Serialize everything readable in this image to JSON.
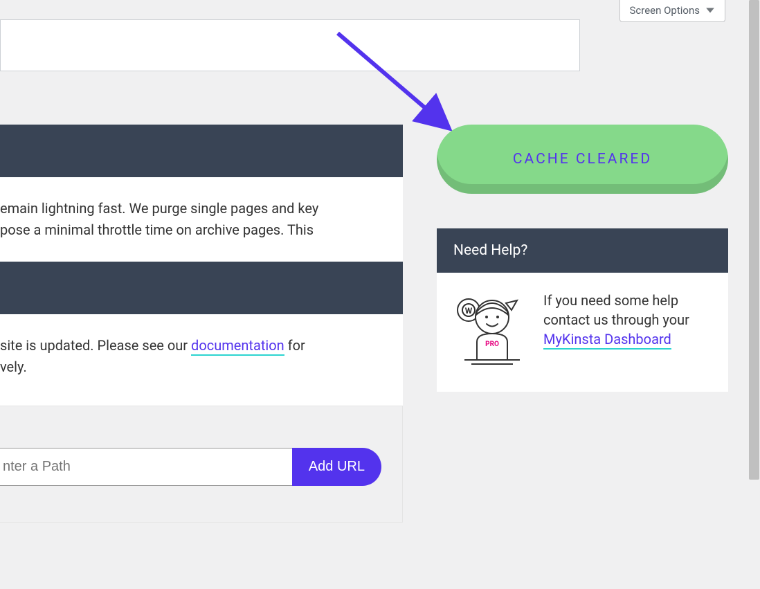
{
  "screen_options": {
    "label": "Screen Options"
  },
  "main": {
    "text1a": "emain lightning fast. We purge single pages and key ",
    "text1b": "pose a minimal throttle time on archive pages. This ",
    "text2a": " site is updated. Please see our ",
    "doc_link": "documentation",
    "text2b": " for ",
    "text2c": "vely.",
    "input_placeholder": "nter a Path",
    "add_url": "Add URL"
  },
  "cache_button": {
    "label": "CACHE CLEARED"
  },
  "help": {
    "title": "Need Help?",
    "pro_badge": "PRO",
    "body_a": "If you need some help contact us through your ",
    "dash_link": "MyKinsta Dashboard"
  }
}
